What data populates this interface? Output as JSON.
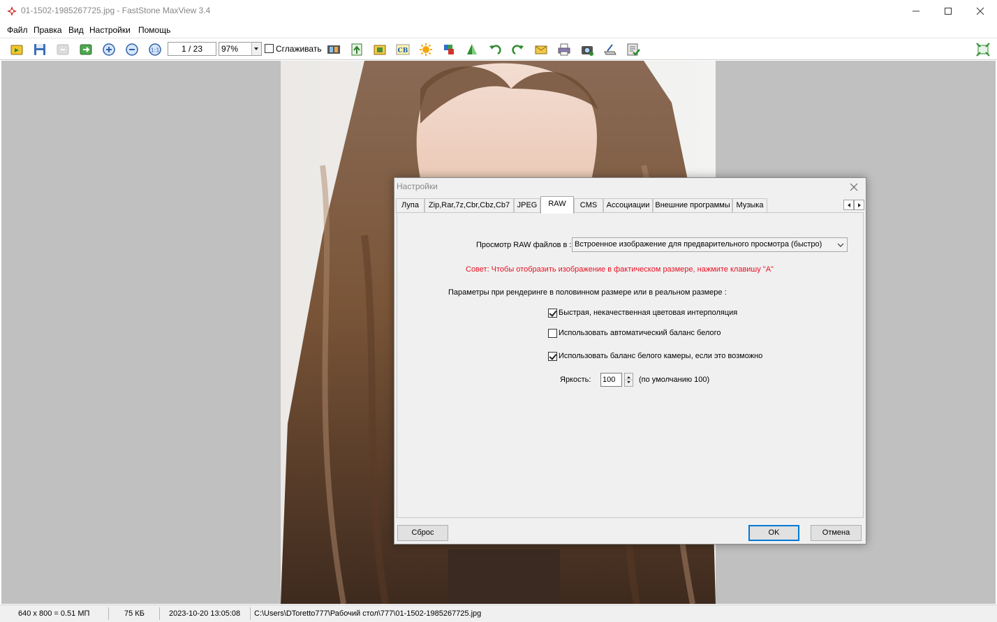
{
  "window": {
    "title": "01-1502-1985267725.jpg - FastStone MaxView 3.4",
    "minimize_icon": "minimize-icon",
    "maximize_icon": "maximize-icon",
    "close_icon": "close-icon"
  },
  "menu": {
    "items": [
      "Файл",
      "Правка",
      "Вид",
      "Настройки",
      "Помощь"
    ]
  },
  "toolbar": {
    "page_indicator": "1 / 23",
    "zoom_value": "97%",
    "smooth_label": "Сглаживать",
    "smooth_checked": false,
    "icons": [
      "open-icon",
      "save-icon",
      "prev-icon",
      "next-icon",
      "zoom-in-icon",
      "zoom-out-icon",
      "actual-size-icon",
      "filmstrip-icon",
      "move-to-icon",
      "copy-to-icon",
      "color-icon",
      "adjust-icon",
      "effects-icon",
      "flip-icon",
      "rotate-left-icon",
      "rotate-right-icon",
      "email-icon",
      "print-icon",
      "capture-icon",
      "scan-icon",
      "settings-icon",
      "fit-screen-icon"
    ]
  },
  "status": {
    "dimensions": "640 x 800 = 0.51 МП",
    "size": "75 КБ",
    "datetime": "2023-10-20 13:05:08",
    "path": "C:\\Users\\DToretto777\\Рабочий стол\\777\\01-1502-1985267725.jpg"
  },
  "dialog": {
    "title": "Настройки",
    "tabs": [
      "Лупа",
      "Zip,Rar,7z,Cbr,Cbz,Cb7",
      "JPEG",
      "RAW",
      "CMS",
      "Ассоциации",
      "Внешние программы",
      "Музыка"
    ],
    "active_tab": "RAW",
    "raw_view_label": "Просмотр RAW файлов в :",
    "raw_view_value": "Встроенное изображение для предварительного просмотра (быстро)",
    "tip": "Совет: Чтобы отобразить изображение в фактическом размере, нажмите клавишу \"A\"",
    "render_params_label": "Параметры при рендеринге в половинном размере или в реальном размере :",
    "options": [
      {
        "label": "Быстрая, некачественная цветовая интерполяция",
        "checked": true
      },
      {
        "label": "Использовать автоматический баланс белого",
        "checked": false
      },
      {
        "label": "Использовать баланс белого камеры, если это возможно",
        "checked": true
      }
    ],
    "brightness_label": "Яркость:",
    "brightness_value": "100",
    "brightness_default": "(по умолчанию 100)",
    "reset_button": "Сброс",
    "ok_button": "OK",
    "cancel_button": "Отмена"
  },
  "colors": {
    "tip_red": "#e81123",
    "viewer_bg": "#c0c0c0",
    "accent": "#0078d7"
  }
}
